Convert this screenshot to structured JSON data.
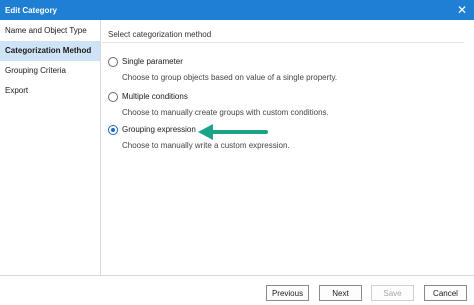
{
  "window": {
    "title": "Edit Category",
    "close_glyph": "✕"
  },
  "sidebar": {
    "items": [
      {
        "label": "Name and Object Type",
        "active": false
      },
      {
        "label": "Categorization Method",
        "active": true
      },
      {
        "label": "Grouping Criteria",
        "active": false
      },
      {
        "label": "Export",
        "active": false
      }
    ]
  },
  "main": {
    "section_title": "Select categorization method",
    "options": [
      {
        "label": "Single parameter",
        "description": "Choose to group objects based on value of a single property.",
        "selected": false
      },
      {
        "label": "Multiple conditions",
        "description": "Choose to manually create groups with custom conditions.",
        "selected": false
      },
      {
        "label": "Grouping expression",
        "description": "Choose to manually write a custom expression.",
        "selected": true
      }
    ],
    "annotation_arrow_color": "#1aa388"
  },
  "footer": {
    "previous_label": "Previous",
    "next_label": "Next",
    "save_label": "Save",
    "cancel_label": "Cancel",
    "save_disabled": true
  },
  "colors": {
    "title_bar": "#1e7fd3",
    "active_nav": "#cfe3f6"
  }
}
